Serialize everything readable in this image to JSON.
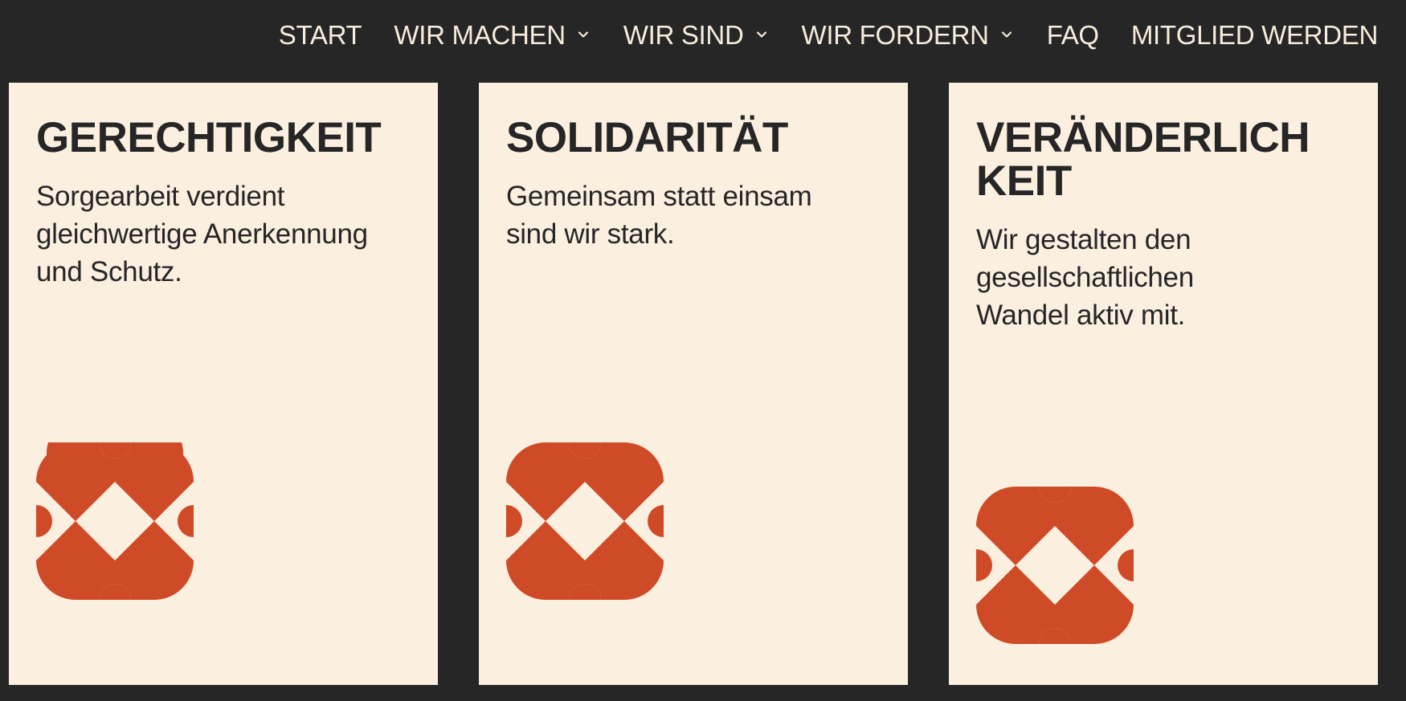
{
  "nav": {
    "items": [
      {
        "label": "START",
        "has_dropdown": false
      },
      {
        "label": "WIR MACHEN",
        "has_dropdown": true,
        "icon": "chevron-down-icon"
      },
      {
        "label": "WIR SIND",
        "has_dropdown": true,
        "icon": "chevron-down-icon"
      },
      {
        "label": "WIR FORDERN",
        "has_dropdown": true,
        "icon": "chevron-down-icon"
      },
      {
        "label": "FAQ",
        "has_dropdown": false
      },
      {
        "label": "MITGLIED WERDEN",
        "has_dropdown": false
      }
    ]
  },
  "cards": [
    {
      "title": "GERECHTIGKEIT",
      "text": "Sorgearbeit verdient gleichwertige Anerkennung und Schutz.",
      "icon": "clover-logo-icon"
    },
    {
      "title": "SOLIDARITÄT",
      "text": "Gemeinsam statt einsam sind wir stark.",
      "icon": "clover-logo-icon"
    },
    {
      "title": "VERÄNDERLICH KEIT",
      "text": "Wir gestalten den gesellschaftlichen Wandel aktiv mit.",
      "icon": "clover-logo-icon"
    }
  ],
  "colors": {
    "background": "#262626",
    "card": "#fbefe0",
    "text_dark": "#262626",
    "nav_text": "#f8ecdd",
    "accent": "#cf4a26"
  }
}
